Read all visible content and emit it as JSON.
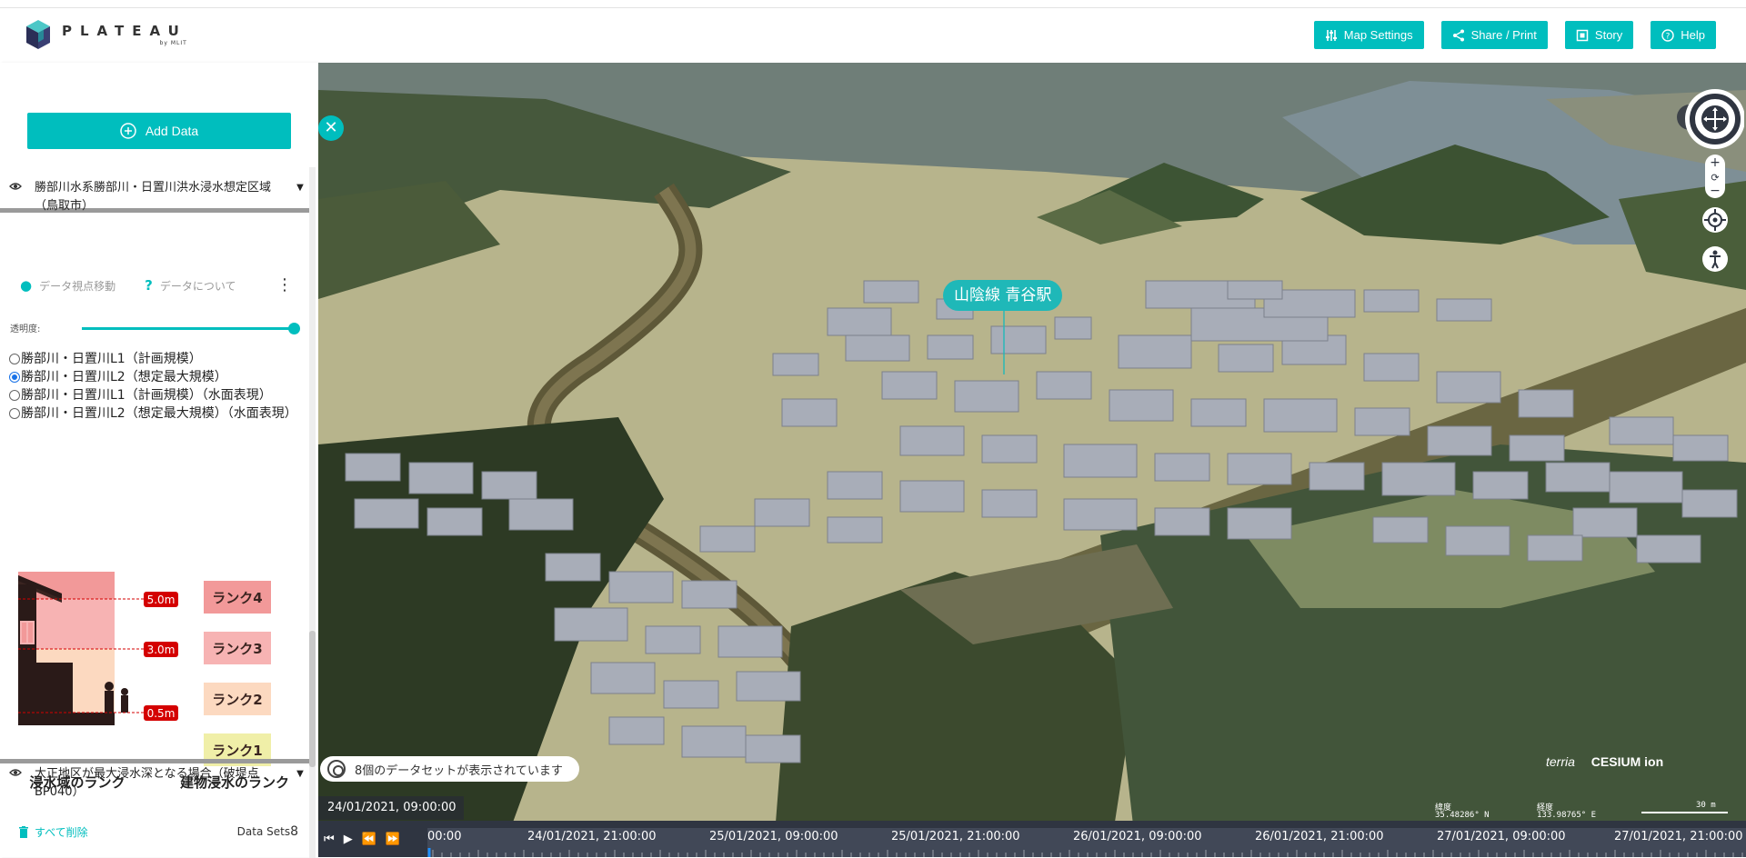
{
  "header": {
    "logo_title": "PLATEAU",
    "logo_sub": "by MLIT",
    "buttons": {
      "map_settings": "Map Settings",
      "share_print": "Share / Print",
      "story": "Story",
      "help": "Help"
    }
  },
  "sidebar": {
    "add_data": "Add Data",
    "dataset1": {
      "title": "勝部川水系勝部川・日置川洪水浸水想定区域（鳥取市）",
      "action_move": "データ視点移動",
      "action_about": "データについて",
      "opacity_label": "透明度:",
      "options": [
        {
          "label": "勝部川・日置川L1（計画規模）",
          "selected": false
        },
        {
          "label": "勝部川・日置川L2（想定最大規模）",
          "selected": true
        },
        {
          "label": "勝部川・日置川L1（計画規模）（水面表現）",
          "selected": false
        },
        {
          "label": "勝部川・日置川L2（想定最大規模）（水面表現）",
          "selected": false
        }
      ],
      "legend": {
        "depths": [
          "5.0m",
          "3.0m",
          "0.5m"
        ],
        "ranks": [
          "ランク4",
          "ランク3",
          "ランク2",
          "ランク1"
        ],
        "caption_left": "浸水域のランク",
        "caption_right": "建物浸水のランク",
        "colors": [
          "#f29999",
          "#f7b3b3",
          "#fcd9c0",
          "#f0efa8"
        ]
      }
    },
    "dataset2": {
      "title": "大正地区が最大浸水深となる場合（破堤点BP040）"
    },
    "delete_all": "すべて削除",
    "datasets_label": "Data Sets",
    "datasets_count": "8"
  },
  "map": {
    "station_label": "山陰線 青谷駅",
    "dataset_pill": "8個のデータセットが表示されています",
    "credits_terria": "terria",
    "credits_cesium": "CESIUM ion",
    "lat_label": "緯度",
    "lat_value": "35.48286° N",
    "lon_label": "経度",
    "lon_value": "133.98765° E",
    "scale": "30 m",
    "nav_help": "?"
  },
  "timeline": {
    "current": "24/01/2021, 09:00:00",
    "labels": [
      "00:00",
      "24/01/2021, 21:00:00",
      "25/01/2021, 09:00:00",
      "25/01/2021, 21:00:00",
      "26/01/2021, 09:00:00",
      "26/01/2021, 21:00:00",
      "27/01/2021, 09:00:00",
      "27/01/2021, 21:00:00"
    ]
  },
  "colors": {
    "accent": "#00bebe",
    "timeline_bg": "#2f3541"
  }
}
